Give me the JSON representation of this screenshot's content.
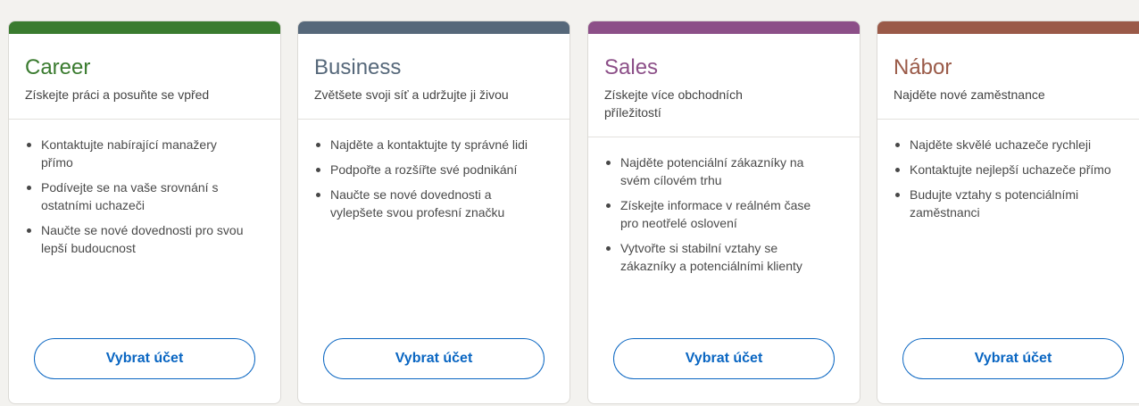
{
  "cards": [
    {
      "title": "Career",
      "subtitle": "Získejte práci a posuňte se vpřed",
      "color": "#3a7b2f",
      "bullets": [
        "Kontaktujte nabírající manažery přímo",
        "Podívejte se na vaše srovnání s ostatními uchazeči",
        "Naučte se nové dovednosti pro svou lepší budoucnost"
      ],
      "button": "Vybrat účet"
    },
    {
      "title": "Business",
      "subtitle": "Zvětšete svoji síť a udržujte ji živou",
      "color": "#56687a",
      "bullets": [
        "Najděte a kontaktujte ty správné lidi",
        "Podpořte a rozšířte své podnikání",
        "Naučte se nové dovednosti a vylepšete svou profesní značku"
      ],
      "button": "Vybrat účet"
    },
    {
      "title": "Sales",
      "subtitle": "Získejte více obchodních příležitostí",
      "color": "#8c4f88",
      "bullets": [
        "Najděte potenciální zákazníky na svém cílovém trhu",
        "Získejte informace v reálném čase pro neotřelé oslovení",
        "Vytvořte si stabilní vztahy se zákazníky a potenciálními klienty"
      ],
      "button": "Vybrat účet"
    },
    {
      "title": "Nábor",
      "subtitle": "Najděte nové zaměstnance",
      "color": "#9a5a48",
      "bullets": [
        "Najděte skvělé uchazeče rychleji",
        "Kontaktujte nejlepší uchazeče přímo",
        "Budujte vztahy s potenciálními zaměstnanci"
      ],
      "button": "Vybrat účet"
    }
  ]
}
